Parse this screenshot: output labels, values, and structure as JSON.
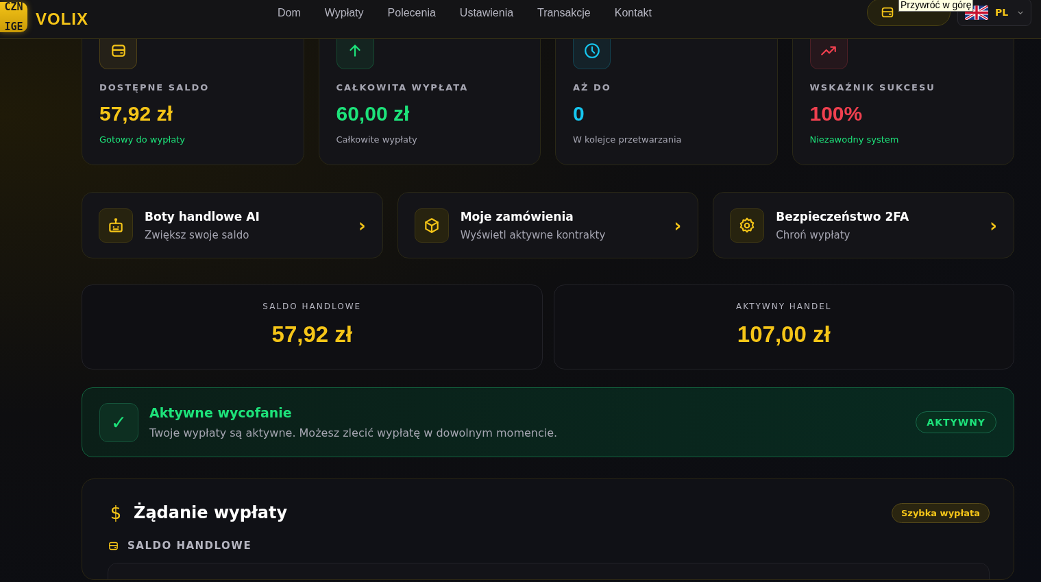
{
  "header": {
    "logo": {
      "lines": [
        "CZN",
        "IGE"
      ]
    },
    "brand": "VOLIX",
    "nav": [
      {
        "label": "Dom"
      },
      {
        "label": "Wypłaty"
      },
      {
        "label": "Polecenia"
      },
      {
        "label": "Ustawienia"
      },
      {
        "label": "Transakcje"
      },
      {
        "label": "Kontakt"
      }
    ],
    "tooltip": "Przywróć w górę",
    "language": {
      "code": "PL"
    }
  },
  "stats": [
    {
      "kind": "wallet",
      "color": "#f5c518",
      "label": "DOSTĘPNE SALDO",
      "value": "57,92 zł",
      "note": "Gotowy do wypłaty",
      "positive": true
    },
    {
      "kind": "arrow",
      "color": "#1de27a",
      "label": "CAŁKOWITA WYPŁATA",
      "value": "60,00 zł",
      "note": "Całkowite wypłaty",
      "positive": false
    },
    {
      "kind": "clock",
      "color": "#16c7f0",
      "label": "AŻ DO",
      "value": "0",
      "note": "W kolejce przetwarzania",
      "positive": false
    },
    {
      "kind": "trend",
      "color": "#f0404f",
      "label": "WSKAŹNIK SUKCESU",
      "value": "100%",
      "note": "Niezawodny system",
      "positive": true
    }
  ],
  "actions": [
    {
      "kind": "robot",
      "title": "Boty handlowe AI",
      "subtitle": "Zwiększ swoje saldo",
      "chevron": "›"
    },
    {
      "kind": "box",
      "title": "Moje zamówienia",
      "subtitle": "Wyświetl aktywne kontrakty",
      "chevron": "›"
    },
    {
      "kind": "gear",
      "title": "Bezpieczeństwo 2FA",
      "subtitle": "Chroń wypłaty",
      "chevron": "›"
    }
  ],
  "balances": [
    {
      "label": "SALDO HANDLOWE",
      "value": "57,92 zł"
    },
    {
      "label": "AKTYWNY HANDEL",
      "value": "107,00 zł"
    }
  ],
  "notice": {
    "mark": "✓",
    "title": "Aktywne wycofanie",
    "text": "Twoje wypłaty są aktywne. Możesz zlecić wypłatę w dowolnym momencie.",
    "badge": "AKTYWNY"
  },
  "withdraw": {
    "icon": "$",
    "title": "Żądanie wypłaty",
    "badge": "Szybka wypłata",
    "section": "SALDO HANDLOWE"
  }
}
